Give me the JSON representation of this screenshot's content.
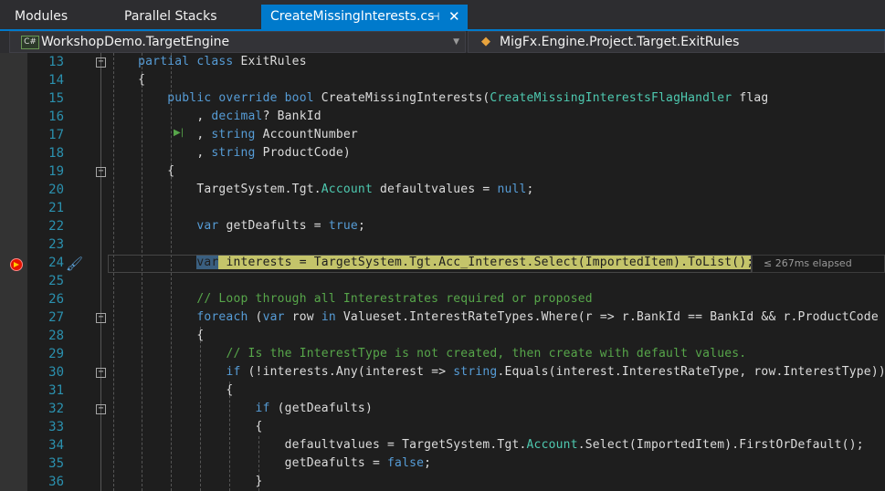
{
  "tabs": [
    {
      "label": "Modules"
    },
    {
      "label": "Parallel Stacks"
    },
    {
      "label": "CreateMissingInterests.cs",
      "active": true,
      "pin_icon": "pin-icon",
      "close_icon": "close-icon"
    }
  ],
  "nav": {
    "project": "WorkshopDemo.TargetEngine",
    "project_badge": "C#",
    "scope": "MigFx.Engine.Project.Target.ExitRules"
  },
  "debug": {
    "current_line": 24,
    "elapsed": "≤ 267ms elapsed",
    "breakpoint_line": 24
  },
  "colors": {
    "accent": "#007acc",
    "keyword": "#569cd6",
    "type": "#4ec9b0",
    "comment": "#57a64a",
    "current_statement": "#c4c46a"
  },
  "lines": [
    {
      "n": "13",
      "fold": "−",
      "t": [
        [
          "    "
        ],
        [
          "partial class ",
          "kw"
        ],
        [
          "ExitRules"
        ]
      ]
    },
    {
      "n": "14",
      "t": [
        [
          "    {"
        ]
      ]
    },
    {
      "n": "15",
      "t": [
        [
          "        "
        ],
        [
          "public override bool ",
          "kw"
        ],
        [
          "CreateMissingInterests("
        ],
        [
          "CreateMissingInterestsFlagHandler",
          "ty"
        ],
        [
          " flag"
        ]
      ]
    },
    {
      "n": "16",
      "t": [
        [
          "            , "
        ],
        [
          "decimal",
          "kw"
        ],
        [
          "? BankId"
        ]
      ]
    },
    {
      "n": "17",
      "t": [
        [
          "            , "
        ],
        [
          "string",
          "kw"
        ],
        [
          " AccountNumber"
        ]
      ]
    },
    {
      "n": "18",
      "t": [
        [
          "            , "
        ],
        [
          "string",
          "kw"
        ],
        [
          " ProductCode)"
        ]
      ]
    },
    {
      "n": "19",
      "fold": "−",
      "t": [
        [
          "        {"
        ]
      ]
    },
    {
      "n": "20",
      "t": [
        [
          "            TargetSystem.Tgt."
        ],
        [
          "Account",
          "ty"
        ],
        [
          " defaultvalues = "
        ],
        [
          "null",
          "kw"
        ],
        [
          ";"
        ]
      ]
    },
    {
      "n": "21",
      "t": [
        [
          ""
        ]
      ]
    },
    {
      "n": "22",
      "t": [
        [
          "            "
        ],
        [
          "var",
          "kw"
        ],
        [
          " getDeafults = "
        ],
        [
          "true",
          "kw"
        ],
        [
          ";"
        ]
      ]
    },
    {
      "n": "23",
      "t": [
        [
          ""
        ]
      ]
    },
    {
      "n": "24",
      "t": [
        [
          "            "
        ],
        [
          "var",
          "sel"
        ],
        [
          " interests = TargetSystem.Tgt.Acc_Interest.Select(ImportedItem).ToList();",
          "cur"
        ]
      ]
    },
    {
      "n": "25",
      "t": [
        [
          ""
        ]
      ]
    },
    {
      "n": "26",
      "t": [
        [
          "            "
        ],
        [
          "// Loop through all Interestrates required or proposed",
          "cm"
        ]
      ]
    },
    {
      "n": "27",
      "fold": "−",
      "t": [
        [
          "            "
        ],
        [
          "foreach",
          "kw"
        ],
        [
          " ("
        ],
        [
          "var",
          "kw"
        ],
        [
          " row "
        ],
        [
          "in",
          "kw"
        ],
        [
          " Valueset.InterestRateTypes.Where(r => r.BankId == BankId && r.ProductCode =="
        ]
      ]
    },
    {
      "n": "28",
      "t": [
        [
          "            {"
        ]
      ]
    },
    {
      "n": "29",
      "t": [
        [
          "                "
        ],
        [
          "// Is the InterestType is not created, then create with default values.",
          "cm"
        ]
      ]
    },
    {
      "n": "30",
      "fold": "−",
      "t": [
        [
          "                "
        ],
        [
          "if",
          "kw"
        ],
        [
          " (!interests.Any(interest => "
        ],
        [
          "string",
          "kw"
        ],
        [
          ".Equals(interest.InterestRateType, row.InterestType))"
        ]
      ]
    },
    {
      "n": "31",
      "t": [
        [
          "                {"
        ]
      ]
    },
    {
      "n": "32",
      "fold": "−",
      "t": [
        [
          "                    "
        ],
        [
          "if",
          "kw"
        ],
        [
          " (getDeafults)"
        ]
      ]
    },
    {
      "n": "33",
      "t": [
        [
          "                    {"
        ]
      ]
    },
    {
      "n": "34",
      "t": [
        [
          "                        defaultvalues = TargetSystem.Tgt."
        ],
        [
          "Account",
          "ty"
        ],
        [
          ".Select(ImportedItem).FirstOrDefault();"
        ]
      ]
    },
    {
      "n": "35",
      "t": [
        [
          "                        getDeafults = "
        ],
        [
          "false",
          "kw"
        ],
        [
          ";"
        ]
      ]
    },
    {
      "n": "36",
      "t": [
        [
          "                    }"
        ]
      ]
    }
  ]
}
